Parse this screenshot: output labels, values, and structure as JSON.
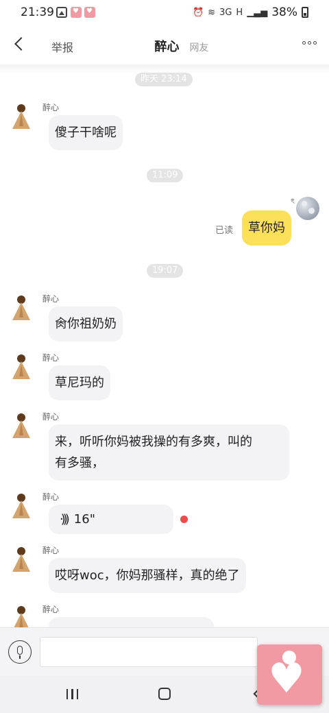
{
  "status_bar": {
    "time": "21:39",
    "network_3g": "3G",
    "network_h": "H",
    "battery": "38%",
    "icons": [
      "image-icon",
      "app-heart-icon",
      "app-heart-icon",
      "alarm-icon",
      "wifi-icon",
      "signal-icon",
      "battery-icon"
    ]
  },
  "header": {
    "back_icon": "chevron-left-icon",
    "report": "举报",
    "title": "醉心",
    "subtitle": "网友",
    "more_icon": "more-dots-icon"
  },
  "chat": {
    "timestamps": [
      "昨天 23:14",
      "11:09",
      "19:07"
    ],
    "messages": [
      {
        "sender": "醉心",
        "text": "傻子干啥呢",
        "direction": "in"
      },
      {
        "text": "草你妈",
        "direction": "out",
        "status": "已读",
        "glyph": "ৎ"
      },
      {
        "sender": "醉心",
        "text": "肏你祖奶奶",
        "direction": "in"
      },
      {
        "sender": "醉心",
        "text": "草尼玛的",
        "direction": "in"
      },
      {
        "sender": "醉心",
        "text": "来，听听你妈被我操的有多爽，叫的",
        "text2": "有多骚，",
        "direction": "in"
      },
      {
        "sender": "醉心",
        "voice_duration": "16\"",
        "direction": "in",
        "type": "voice",
        "unread": true
      },
      {
        "sender": "醉心",
        "text": "哎呀woc，你妈那骚样，真的绝了",
        "direction": "in"
      },
      {
        "sender": "醉心",
        "text": "",
        "direction": "in"
      }
    ]
  },
  "input": {
    "placeholder": "",
    "mic_icon": "microphone-icon"
  },
  "nav": {
    "recent_icon": "recent-apps-icon",
    "home_icon": "home-icon",
    "back_icon": "back-icon"
  },
  "colors": {
    "outgoing_bubble": "#fde05a",
    "incoming_bubble": "#f3f3f6",
    "unread_dot": "#f04a4a",
    "app_pink": "#f19aa3"
  }
}
